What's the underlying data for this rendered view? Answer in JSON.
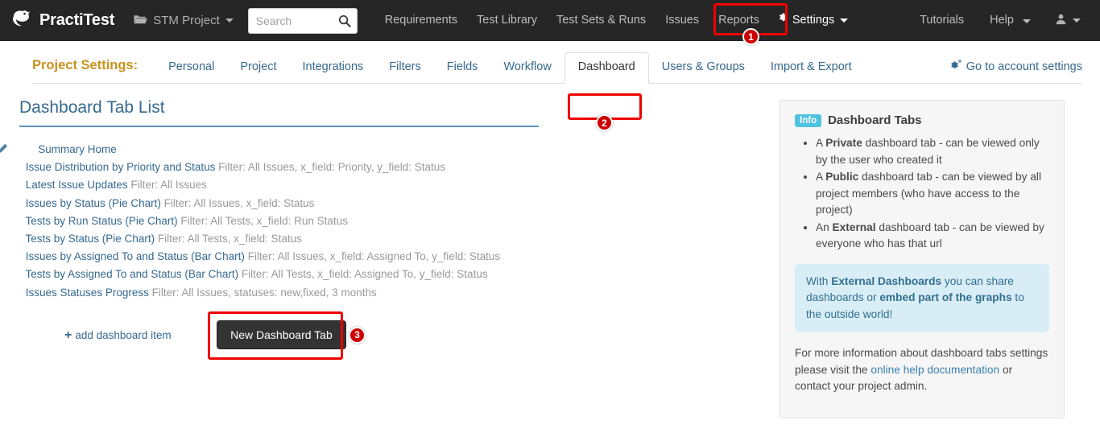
{
  "topbar": {
    "brand": "PractiTest",
    "brand_logo_icon": "practitest-bird-logo",
    "project": {
      "label": "STM Project",
      "icon": "folder-open-icon"
    },
    "search": {
      "placeholder": "Search",
      "value": "",
      "icon": "search-icon"
    },
    "links": [
      {
        "label": "Requirements",
        "name": "requirements"
      },
      {
        "label": "Test Library",
        "name": "test-library"
      },
      {
        "label": "Test Sets & Runs",
        "name": "test-sets-runs"
      },
      {
        "label": "Issues",
        "name": "issues"
      },
      {
        "label": "Reports",
        "name": "reports"
      }
    ],
    "settings": {
      "label": "Settings",
      "icon": "gear-icon"
    },
    "right_links": [
      {
        "label": "Tutorials",
        "name": "tutorials"
      },
      {
        "label": "Help",
        "name": "help"
      }
    ],
    "account": {
      "icon": "user-avatar-icon"
    }
  },
  "subnav": {
    "title": "Project Settings:",
    "tabs": [
      {
        "label": "Personal",
        "name": "personal",
        "active": false
      },
      {
        "label": "Project",
        "name": "project",
        "active": false
      },
      {
        "label": "Integrations",
        "name": "integrations",
        "active": false
      },
      {
        "label": "Filters",
        "name": "filters",
        "active": false
      },
      {
        "label": "Fields",
        "name": "fields",
        "active": false
      },
      {
        "label": "Workflow",
        "name": "workflow",
        "active": false
      },
      {
        "label": "Dashboard",
        "name": "dashboard",
        "active": true
      },
      {
        "label": "Users & Groups",
        "name": "users-groups",
        "active": false
      },
      {
        "label": "Import & Export",
        "name": "import-export",
        "active": false
      }
    ],
    "account_settings": {
      "label": "Go to account settings",
      "icon": "gears-icon"
    }
  },
  "main": {
    "page_title": "Dashboard Tab List",
    "items": [
      {
        "level": "root",
        "icons": [
          "copy-icon",
          "trash-icon",
          "pencil-icon"
        ],
        "link": "Summary Home",
        "meta": ""
      },
      {
        "level": "child",
        "icons": [
          "trash-icon"
        ],
        "link": "Issue Distribution by Priority and Status",
        "meta": "Filter: All Issues, x_field: Priority, y_field: Status"
      },
      {
        "level": "child",
        "icons": [
          "trash-icon"
        ],
        "link": "Latest Issue Updates",
        "meta": "Filter: All Issues"
      },
      {
        "level": "child",
        "icons": [
          "trash-icon"
        ],
        "link": "Issues by Status (Pie Chart)",
        "meta": "Filter: All Issues, x_field: Status"
      },
      {
        "level": "child",
        "icons": [
          "trash-icon"
        ],
        "link": "Tests by Run Status (Pie Chart)",
        "meta": "Filter: All Tests, x_field: Run Status"
      },
      {
        "level": "child",
        "icons": [
          "trash-icon"
        ],
        "link": "Tests by Status (Pie Chart)",
        "meta": "Filter: All Tests, x_field: Status"
      },
      {
        "level": "child",
        "icons": [
          "trash-icon"
        ],
        "link": "Issues by Assigned To and Status (Bar Chart)",
        "meta": "Filter: All Issues, x_field: Assigned To, y_field: Status"
      },
      {
        "level": "child",
        "icons": [
          "trash-icon"
        ],
        "link": "Tests by Assigned To and Status (Bar Chart)",
        "meta": "Filter: All Tests, x_field: Assigned To, y_field: Status"
      },
      {
        "level": "child",
        "icons": [
          "trash-icon"
        ],
        "link": "Issues Statuses Progress",
        "meta": "Filter: All Issues, statuses: new,fixed, 3 months"
      }
    ],
    "add_item_label": "add dashboard item",
    "add_item_icon": "plus-icon",
    "new_tab_button": "New Dashboard Tab"
  },
  "info_panel": {
    "badge": "Info",
    "title": "Dashboard Tabs",
    "bullets": [
      {
        "bold": "Private",
        "before": "A ",
        "after": " dashboard tab - can be viewed only by the user who created it"
      },
      {
        "bold": "Public",
        "before": "A ",
        "after": " dashboard tab - can be viewed by all project members (who have access to the project)"
      },
      {
        "bold": "External",
        "before": "An ",
        "after": " dashboard tab - can be viewed by everyone who has that url"
      }
    ],
    "note": {
      "p1": "With ",
      "b1": "External Dashboards",
      "p2": " you can share dashboards or ",
      "b2": "embed part of the graphs",
      "p3": " to the outside world!"
    },
    "footer": {
      "p1": "For more information about dashboard tabs settings please visit the ",
      "link": "online help documentation",
      "p2": " or contact your project admin."
    }
  },
  "annotations": {
    "steps": [
      "1",
      "2",
      "3"
    ],
    "highlight_color": "#ee0000",
    "badge_color": "#cc0000"
  }
}
